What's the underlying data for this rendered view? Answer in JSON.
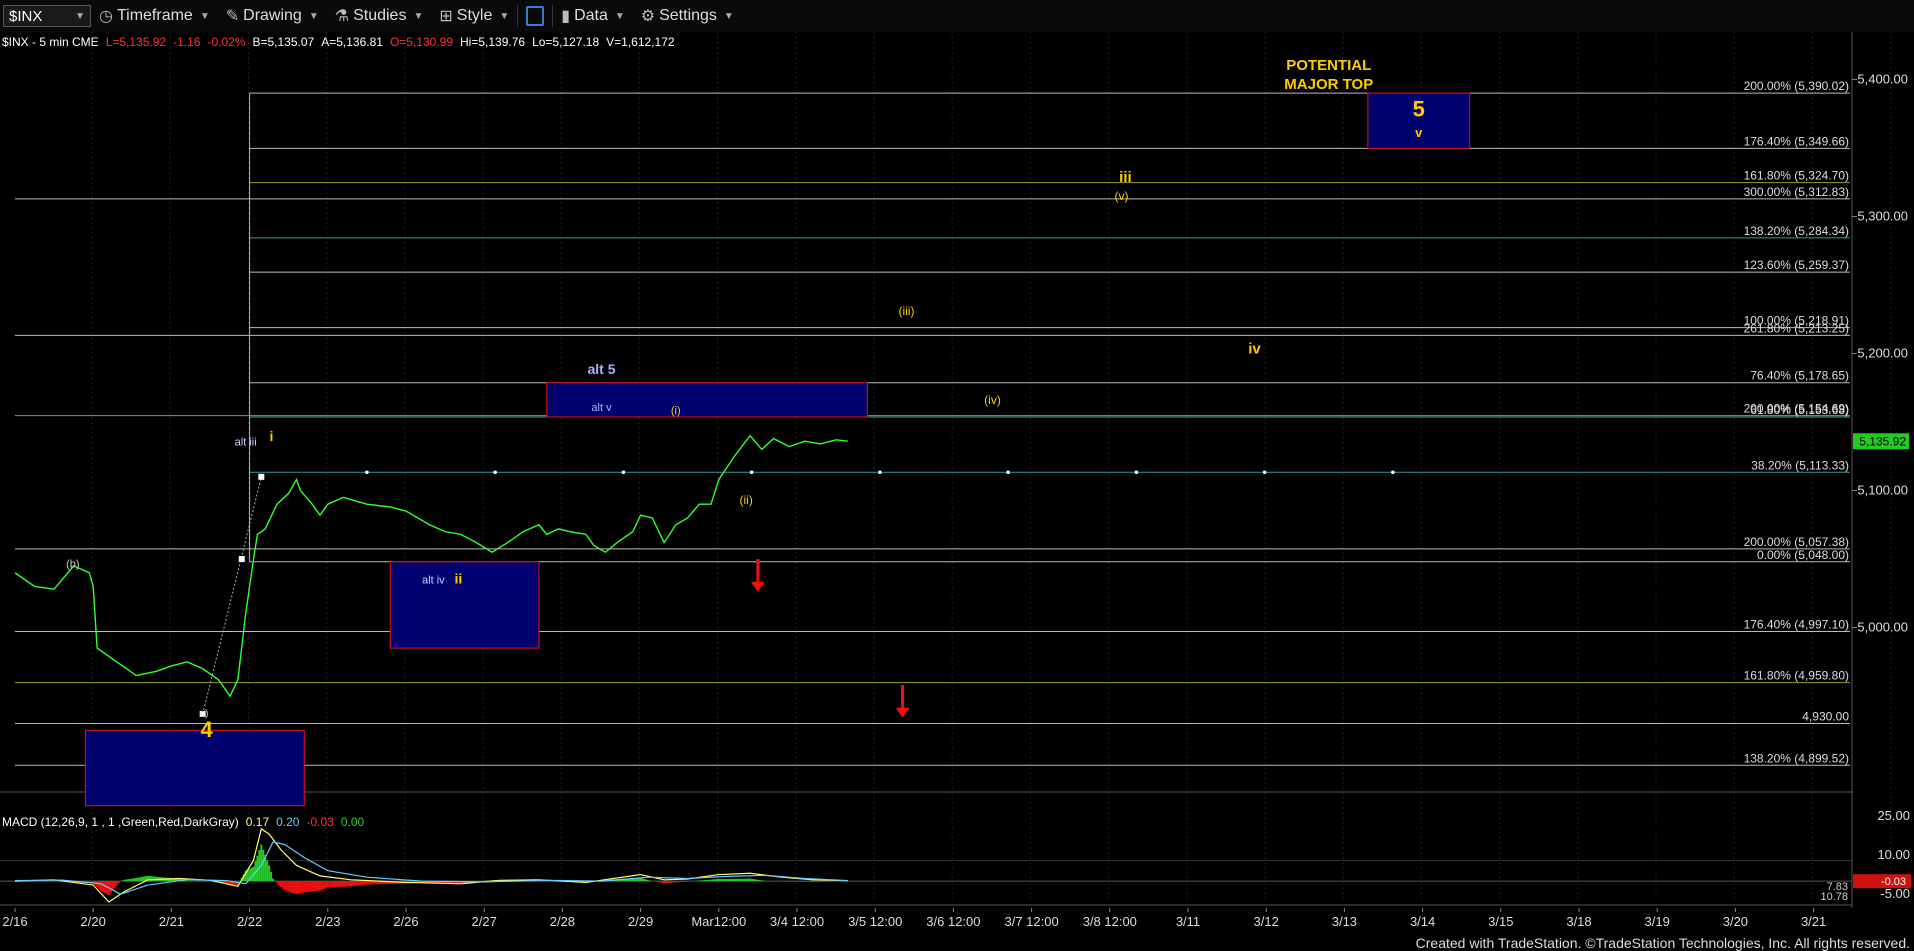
{
  "toolbar": {
    "symbol": "$INX",
    "timeframe": "Timeframe",
    "drawing": "Drawing",
    "studies": "Studies",
    "style": "Style",
    "data": "Data",
    "settings": "Settings"
  },
  "header_items": [
    {
      "text": "$INX - 5 min  CME",
      "color": "#ffffff"
    },
    {
      "text": "L=5,135.92",
      "color": "#ff3333"
    },
    {
      "text": "-1.16",
      "color": "#ff3333"
    },
    {
      "text": "-0.02%",
      "color": "#ff3333"
    },
    {
      "text": "B=5,135.07",
      "color": "#ffffff"
    },
    {
      "text": "A=5,136.81",
      "color": "#ffffff"
    },
    {
      "text": "O=5,130.99",
      "color": "#ff3333"
    },
    {
      "text": "Hi=5,139.76",
      "color": "#ffffff"
    },
    {
      "text": "Lo=5,127.18",
      "color": "#ffffff"
    },
    {
      "text": "V=1,612,172",
      "color": "#ffffff"
    }
  ],
  "macd_header": [
    {
      "text": "MACD (12,26,9, 1 , 1 ,Green,Red,DarkGray)",
      "color": "#ffffff"
    },
    {
      "text": "0.17",
      "color": "#ffff66"
    },
    {
      "text": "0.20",
      "color": "#66ccff"
    },
    {
      "text": "-0.03",
      "color": "#ff3333"
    },
    {
      "text": "0.00",
      "color": "#33cc33"
    }
  ],
  "footer": "Created with TradeStation. ©TradeStation Technologies, Inc. All rights reserved.",
  "chart_data": [
    {
      "type": "line",
      "series": [
        {
          "values": [
            [
              0,
              5040
            ],
            [
              0.25,
              5030
            ],
            [
              0.5,
              5028
            ],
            [
              0.75,
              5045
            ],
            [
              0.95,
              5040
            ],
            [
              1.0,
              5030
            ],
            [
              1.05,
              4985
            ],
            [
              1.3,
              4975
            ],
            [
              1.55,
              4965
            ],
            [
              1.8,
              4968
            ],
            [
              2.0,
              4972
            ],
            [
              2.2,
              4975
            ],
            [
              2.4,
              4970
            ],
            [
              2.6,
              4962
            ],
            [
              2.75,
              4950
            ],
            [
              2.85,
              4962
            ],
            [
              2.95,
              5010
            ],
            [
              3.0,
              5030
            ],
            [
              3.05,
              5050
            ],
            [
              3.1,
              5068
            ],
            [
              3.2,
              5072
            ],
            [
              3.35,
              5090
            ],
            [
              3.5,
              5098
            ],
            [
              3.6,
              5108
            ],
            [
              3.65,
              5100
            ],
            [
              3.8,
              5090
            ],
            [
              3.9,
              5082
            ],
            [
              4.0,
              5090
            ],
            [
              4.2,
              5095
            ],
            [
              4.5,
              5090
            ],
            [
              4.8,
              5088
            ],
            [
              5.0,
              5085
            ],
            [
              5.3,
              5075
            ],
            [
              5.5,
              5070
            ],
            [
              5.7,
              5068
            ],
            [
              5.9,
              5062
            ],
            [
              6.1,
              5055
            ],
            [
              6.3,
              5062
            ],
            [
              6.5,
              5070
            ],
            [
              6.7,
              5075
            ],
            [
              6.8,
              5068
            ],
            [
              6.95,
              5072
            ],
            [
              7.1,
              5070
            ],
            [
              7.3,
              5068
            ],
            [
              7.4,
              5060
            ],
            [
              7.55,
              5055
            ],
            [
              7.7,
              5062
            ],
            [
              7.9,
              5070
            ],
            [
              8.0,
              5082
            ],
            [
              8.15,
              5080
            ],
            [
              8.3,
              5062
            ],
            [
              8.45,
              5075
            ],
            [
              8.6,
              5080
            ],
            [
              8.75,
              5090
            ],
            [
              8.9,
              5090
            ],
            [
              9.0,
              5108
            ],
            [
              9.2,
              5125
            ],
            [
              9.4,
              5140
            ],
            [
              9.55,
              5130
            ],
            [
              9.7,
              5138
            ],
            [
              9.9,
              5132
            ],
            [
              10.1,
              5136
            ],
            [
              10.3,
              5134
            ],
            [
              10.5,
              5137
            ],
            [
              10.65,
              5136
            ]
          ]
        },
        {
          "values": [
            [
              0,
              0
            ],
            [
              0.5,
              0.5
            ],
            [
              1.0,
              -1.5
            ],
            [
              1.2,
              -8
            ],
            [
              1.4,
              -4
            ],
            [
              1.7,
              0.5
            ],
            [
              2.1,
              1
            ],
            [
              2.5,
              0.3
            ],
            [
              2.85,
              -2
            ],
            [
              3.05,
              8
            ],
            [
              3.15,
              20
            ],
            [
              3.25,
              18
            ],
            [
              3.4,
              12
            ],
            [
              3.6,
              6
            ],
            [
              3.9,
              2
            ],
            [
              4.3,
              0.5
            ],
            [
              5.0,
              -0.5
            ],
            [
              5.7,
              -1
            ],
            [
              6.2,
              0.3
            ],
            [
              6.7,
              0.5
            ],
            [
              7.3,
              -0.5
            ],
            [
              8.0,
              2.5
            ],
            [
              8.3,
              0.5
            ],
            [
              8.6,
              0.8
            ],
            [
              9.0,
              2.5
            ],
            [
              9.4,
              3
            ],
            [
              9.8,
              1.5
            ],
            [
              10.2,
              0.5
            ],
            [
              10.65,
              0.17
            ]
          ]
        },
        {
          "values": [
            [
              0,
              0.2
            ],
            [
              0.6,
              0.4
            ],
            [
              1.1,
              -1
            ],
            [
              1.35,
              -5
            ],
            [
              1.7,
              -1.5
            ],
            [
              2.2,
              0.6
            ],
            [
              2.7,
              0.2
            ],
            [
              2.95,
              -1
            ],
            [
              3.15,
              6
            ],
            [
              3.3,
              15
            ],
            [
              3.45,
              14
            ],
            [
              3.7,
              9
            ],
            [
              4.0,
              4
            ],
            [
              4.5,
              1.5
            ],
            [
              5.2,
              0
            ],
            [
              6.0,
              -0.3
            ],
            [
              6.8,
              0.3
            ],
            [
              7.5,
              0
            ],
            [
              8.1,
              1.5
            ],
            [
              8.6,
              1
            ],
            [
              9.1,
              1.8
            ],
            [
              9.6,
              2.2
            ],
            [
              10.1,
              1
            ],
            [
              10.65,
              0.2
            ]
          ]
        }
      ],
      "x_ticks": [
        "2/16",
        "2/20",
        "2/21",
        "2/22",
        "2/23",
        "2/26",
        "2/27",
        "2/28",
        "2/29",
        "Mar12:00",
        "3/4 12:00",
        "3/5 12:00",
        "3/6 12:00",
        "3/7 12:00",
        "3/8 12:00",
        "3/11",
        "3/12",
        "3/13",
        "3/14",
        "3/15",
        "3/18",
        "3/19",
        "3/20",
        "3/21"
      ],
      "y_ticks": [
        5000.0,
        5100.0,
        5200.0,
        5300.0,
        5400.0
      ],
      "ylim": [
        4880,
        5420
      ],
      "last_price": "5,135.92",
      "fib_levels": [
        {
          "label": "200.00% (5,390.02)",
          "value": 5390.02,
          "color": "#bbbbbb",
          "x0": 3.0
        },
        {
          "label": "176.40% (5,349.66)",
          "value": 5349.66,
          "color": "#bbbbbb",
          "x0": 3.0
        },
        {
          "label": "161.80% (5,324.70)",
          "value": 5324.7,
          "color": "#999933",
          "x0": 3.0
        },
        {
          "label": "300.00% (5,312.83)",
          "value": 5312.83,
          "color": "#bbbbbb",
          "x0": 0.0
        },
        {
          "label": "138.20% (5,284.34)",
          "value": 5284.34,
          "color": "#339999",
          "x0": 3.0
        },
        {
          "label": "123.60% (5,259.37)",
          "value": 5259.37,
          "color": "#bbbbbb",
          "x0": 3.0
        },
        {
          "label": "100.00% (5,218.91)",
          "value": 5218.91,
          "color": "#bbbbbb",
          "x0": 3.0
        },
        {
          "label": "261.80% (5,213.25)",
          "value": 5213.25,
          "color": "#bbbbbb",
          "x0": 0.0
        },
        {
          "label": "76.40% (5,178.65)",
          "value": 5178.65,
          "color": "#bbbbbb",
          "x0": 3.0
        },
        {
          "label": "200.00% (5,154.69)",
          "value": 5154.69,
          "color": "#999933",
          "x0": 0.0
        },
        {
          "label": "61.80% (5,153.68)",
          "value": 5153.68,
          "color": "#339999",
          "x0": 3.0
        },
        {
          "label": "38.20% (5,113.33)",
          "value": 5113.33,
          "color": "#339999",
          "x0": 3.0,
          "dotted": true
        },
        {
          "label": "200.00% (5,057.38)",
          "value": 5057.38,
          "color": "#bbbbbb",
          "x0": 0.0
        },
        {
          "label": "0.00% (5,048.00)",
          "value": 5048.0,
          "color": "#bbbbbb",
          "x0": 3.0
        },
        {
          "label": "176.40% (4,997.10)",
          "value": 4997.1,
          "color": "#bbbbbb",
          "x0": 0.0
        },
        {
          "label": "161.80% (4,959.80)",
          "value": 4959.8,
          "color": "#999933",
          "x0": 0.0
        },
        {
          "label": "4,930.00",
          "value": 4930.0,
          "color": "#bbbbbb",
          "x0": 0.0
        },
        {
          "label": "138.20% (4,899.52)",
          "value": 4899.52,
          "color": "#bbbbbb",
          "x0": 0.0
        }
      ],
      "target_boxes": [
        {
          "x": [
            17.3,
            18.6
          ],
          "y": [
            5349.66,
            5390.02
          ]
        },
        {
          "x": [
            6.8,
            10.9
          ],
          "y": [
            5153.68,
            5178.65
          ]
        },
        {
          "x": [
            4.8,
            6.7
          ],
          "y": [
            4985,
            5048
          ]
        },
        {
          "x": [
            0.9,
            3.7
          ],
          "y": [
            4870,
            4925
          ]
        }
      ],
      "wave_labels": [
        {
          "text": "POTENTIAL",
          "x": 16.8,
          "y": 5407,
          "color": "#ffcc00",
          "size": 15,
          "bold": true
        },
        {
          "text": "MAJOR TOP",
          "x": 16.8,
          "y": 5393,
          "color": "#ffcc00",
          "size": 15,
          "bold": true
        },
        {
          "text": "5",
          "x": 17.95,
          "y": 5373,
          "color": "#ffcc00",
          "size": 22,
          "bold": true
        },
        {
          "text": "v",
          "x": 17.95,
          "y": 5358,
          "color": "#ffcc00",
          "size": 13,
          "bold": true
        },
        {
          "text": "iii",
          "x": 14.2,
          "y": 5325,
          "color": "#ffcc00",
          "size": 15,
          "bold": true
        },
        {
          "text": "(v)",
          "x": 14.15,
          "y": 5312,
          "color": "#ffcc00",
          "size": 12
        },
        {
          "text": "(iii)",
          "x": 11.4,
          "y": 5228,
          "color": "#ffcc00",
          "size": 12
        },
        {
          "text": "iv",
          "x": 15.85,
          "y": 5200,
          "color": "#ffcc00",
          "size": 15,
          "bold": true
        },
        {
          "text": "(iv)",
          "x": 12.5,
          "y": 5163,
          "color": "#ffcc00",
          "size": 12
        },
        {
          "text": "alt 5",
          "x": 7.5,
          "y": 5185,
          "color": "#aab0ff",
          "size": 14,
          "bold": true
        },
        {
          "text": "alt v",
          "x": 7.5,
          "y": 5158,
          "color": "#aab0ff",
          "size": 11
        },
        {
          "text": "(i)",
          "x": 8.45,
          "y": 5156,
          "color": "#ffcc00",
          "size": 11
        },
        {
          "text": "(ii)",
          "x": 9.35,
          "y": 5090,
          "color": "#ffcc00",
          "size": 12
        },
        {
          "text": "alt iii",
          "x": 2.95,
          "y": 5133,
          "color": "#cfd3ff",
          "size": 11
        },
        {
          "text": "i",
          "x": 3.28,
          "y": 5136,
          "color": "#ffcc00",
          "size": 14,
          "bold": true
        },
        {
          "text": "(b)",
          "x": 0.74,
          "y": 5044,
          "color": "#cccccc",
          "size": 11
        },
        {
          "text": "alt iv",
          "x": 5.35,
          "y": 5032,
          "color": "#cfd3ff",
          "size": 11
        },
        {
          "text": "ii",
          "x": 5.67,
          "y": 5032,
          "color": "#ffcc00",
          "size": 14,
          "bold": true
        },
        {
          "text": "c)",
          "x": 2.42,
          "y": 4935,
          "color": "#cccccc",
          "size": 10
        },
        {
          "text": "4",
          "x": 2.45,
          "y": 4920,
          "color": "#ffcc00",
          "size": 22,
          "bold": true
        }
      ],
      "arrows": [
        {
          "x": 9.5,
          "y1": 5050,
          "y2": 5032
        },
        {
          "x": 11.35,
          "y1": 4958,
          "y2": 4940
        }
      ],
      "white_markers": [
        {
          "x": 3.15,
          "y": 5110
        },
        {
          "x": 2.9,
          "y": 5050
        },
        {
          "x": 2.4,
          "y": 4937
        }
      ]
    },
    {
      "type": "area",
      "y_ticks": [
        25.0,
        10.0,
        -5.0
      ],
      "ylim": [
        -8,
        28
      ],
      "right_labels": [
        "-0.03",
        "7.83",
        "10.78"
      ]
    }
  ]
}
